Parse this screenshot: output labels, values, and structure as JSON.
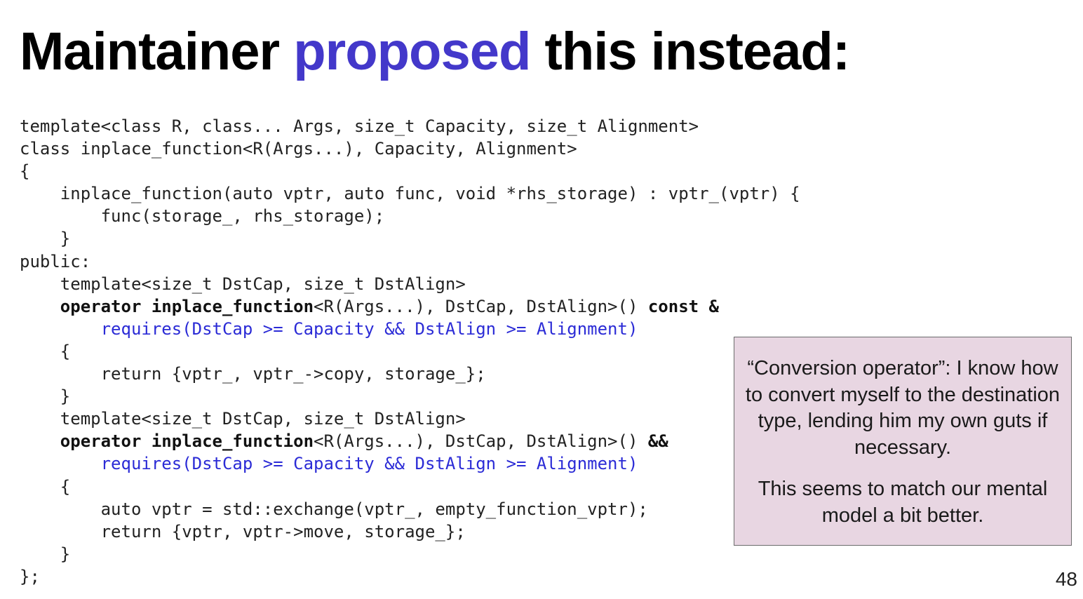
{
  "slide": {
    "title_part1": "Maintainer ",
    "title_accent": "proposed",
    "title_part2": " this instead:",
    "page_number": "48"
  },
  "code_lines": [
    "template<class R, class... Args, size_t Capacity, size_t Alignment>",
    "class inplace_function<R(Args...), Capacity, Alignment>",
    "{",
    "    inplace_function(auto vptr, auto func, void *rhs_storage) : vptr_(vptr) {",
    "        func(storage_, rhs_storage);",
    "    }",
    "public:",
    "    template<size_t DstCap, size_t DstAlign>",
    [
      {
        "t": "    "
      },
      {
        "t": "operator inplace_function",
        "c": "kw"
      },
      {
        "t": "<R(Args...), DstCap, DstAlign>() "
      },
      {
        "t": "const &",
        "c": "kw"
      }
    ],
    [
      {
        "t": "        "
      },
      {
        "t": "requires(DstCap >= Capacity && DstAlign >= Alignment)",
        "c": "req"
      }
    ],
    "    {",
    "        return {vptr_, vptr_->copy, storage_};",
    "    }",
    "    template<size_t DstCap, size_t DstAlign>",
    [
      {
        "t": "    "
      },
      {
        "t": "operator inplace_function",
        "c": "kw"
      },
      {
        "t": "<R(Args...), DstCap, DstAlign>() "
      },
      {
        "t": "&&",
        "c": "kw"
      }
    ],
    [
      {
        "t": "        "
      },
      {
        "t": "requires(DstCap >= Capacity && DstAlign >= Alignment)",
        "c": "req"
      }
    ],
    "    {",
    "        auto vptr = std::exchange(vptr_, empty_function_vptr);",
    "        return {vptr, vptr->move, storage_};",
    "    }",
    "};"
  ],
  "callout": {
    "paragraph1": "“Conversion operator”: I know how to convert myself to the destination type, lending him my own guts if necessary.",
    "paragraph2": "This seems to match our mental model a bit better."
  }
}
